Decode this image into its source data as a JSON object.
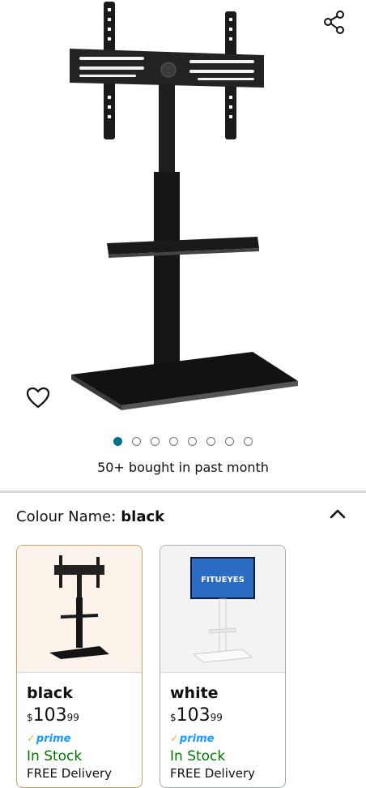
{
  "gallery": {
    "total_images": 8,
    "active_index": 0,
    "bought_text": "50+ bought in past month",
    "accent_color": "#007185"
  },
  "icons": {
    "share": "share-icon",
    "wishlist": "heart-outline-icon",
    "collapse": "chevron-up-icon"
  },
  "variation": {
    "label": "Colour Name:",
    "selected": "black",
    "options": [
      {
        "name": "black",
        "currency": "$",
        "price_whole": "103",
        "price_fraction": "99",
        "prime": "prime",
        "stock": "In Stock",
        "delivery": "FREE Delivery"
      },
      {
        "name": "white",
        "currency": "$",
        "price_whole": "103",
        "price_fraction": "99",
        "prime": "prime",
        "stock": "In Stock",
        "delivery": "FREE Delivery",
        "brand_on_screen": "FITUEYES"
      }
    ]
  }
}
